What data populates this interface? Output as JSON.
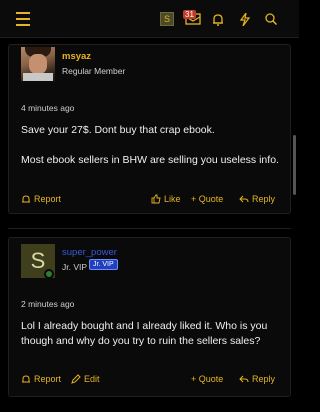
{
  "header": {
    "user_initial": "S",
    "notification_count": "31"
  },
  "posts": [
    {
      "username": "msyaz",
      "title": "Regular Member",
      "rank_badge": "",
      "timestamp": "4 minutes ago",
      "paragraphs": [
        "Save your 27$. Dont buy that crap ebook.",
        "Most ebook sellers in BHW are selling you useless info."
      ],
      "actions": {
        "report": "Report",
        "like": "Like",
        "quote": "+ Quote",
        "reply": "Reply"
      }
    },
    {
      "username": "super_power",
      "avatar_initial": "S",
      "title": "Jr. VIP",
      "rank_badge": "Jr. VIP",
      "timestamp": "2 minutes ago",
      "paragraphs": [
        "Lol I already bought and I already liked it. Who is you though and why do you try to ruin the sellers sales?"
      ],
      "actions": {
        "report": "Report",
        "edit": "Edit",
        "quote": "+ Quote",
        "reply": "Reply"
      }
    }
  ],
  "colors": {
    "accent": "#e6b422",
    "background": "#000000",
    "link_blue": "#3a5bd9"
  }
}
